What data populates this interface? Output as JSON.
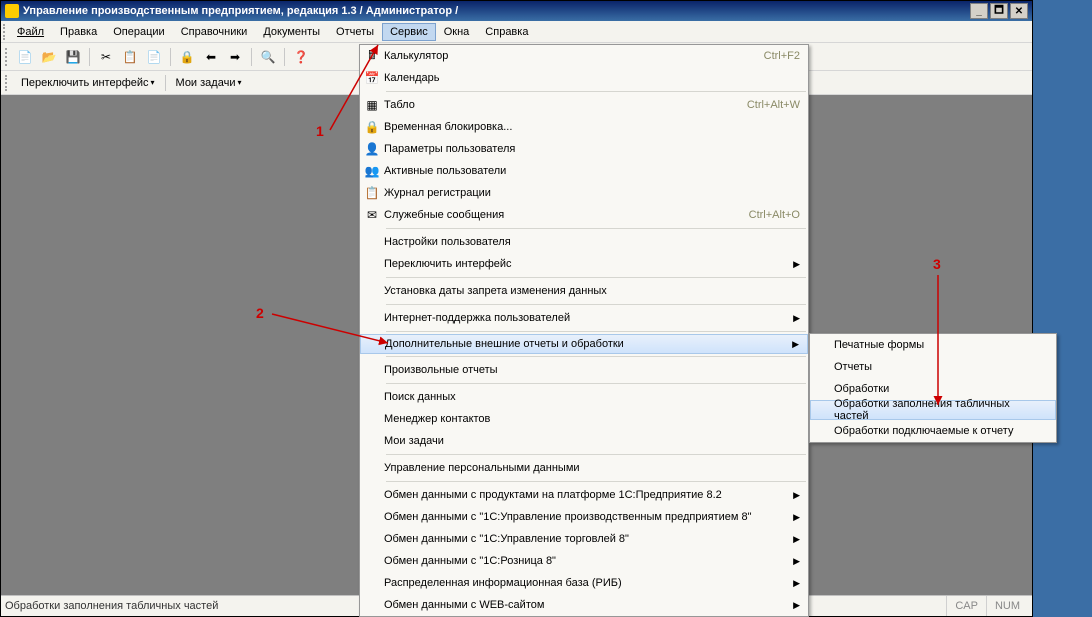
{
  "title": "Управление производственным предприятием, редакция 1.3 / Администратор /",
  "menubar": [
    "Файл",
    "Правка",
    "Операции",
    "Справочники",
    "Документы",
    "Отчеты",
    "Сервис",
    "Окна",
    "Справка"
  ],
  "subbar": {
    "switch": "Переключить интерфейс",
    "tasks": "Мои задачи"
  },
  "status": {
    "text": "Обработки заполнения табличных частей",
    "cap": "CAP",
    "num": "NUM"
  },
  "menu": {
    "items": [
      {
        "icon": "🖩",
        "label": "Калькулятор",
        "shortcut": "Ctrl+F2"
      },
      {
        "icon": "📅",
        "label": "Календарь",
        "shortcut": ""
      },
      {
        "sep": true
      },
      {
        "icon": "▦",
        "label": "Табло",
        "shortcut": "Ctrl+Alt+W"
      },
      {
        "icon": "🔒",
        "label": "Временная блокировка...",
        "shortcut": ""
      },
      {
        "icon": "👤",
        "label": "Параметры пользователя",
        "shortcut": ""
      },
      {
        "icon": "👥",
        "label": "Активные пользователи",
        "shortcut": ""
      },
      {
        "icon": "📋",
        "label": "Журнал регистрации",
        "shortcut": ""
      },
      {
        "icon": "✉",
        "label": "Служебные сообщения",
        "shortcut": "Ctrl+Alt+O"
      },
      {
        "sep": true
      },
      {
        "icon": "",
        "label": "Настройки пользователя",
        "shortcut": ""
      },
      {
        "icon": "",
        "label": "Переключить интерфейс",
        "shortcut": "",
        "sub": true
      },
      {
        "sep": true
      },
      {
        "icon": "",
        "label": "Установка даты запрета изменения данных",
        "shortcut": ""
      },
      {
        "sep": true
      },
      {
        "icon": "",
        "label": "Интернет-поддержка пользователей",
        "shortcut": "",
        "sub": true
      },
      {
        "sep": true
      },
      {
        "icon": "",
        "label": "Дополнительные внешние отчеты и обработки",
        "shortcut": "",
        "sub": true,
        "hl": true
      },
      {
        "sep": true
      },
      {
        "icon": "",
        "label": "Произвольные отчеты",
        "shortcut": ""
      },
      {
        "sep": true
      },
      {
        "icon": "",
        "label": "Поиск данных",
        "shortcut": ""
      },
      {
        "icon": "",
        "label": "Менеджер контактов",
        "shortcut": ""
      },
      {
        "icon": "",
        "label": "Мои задачи",
        "shortcut": ""
      },
      {
        "sep": true
      },
      {
        "icon": "",
        "label": "Управление персональными данными",
        "shortcut": ""
      },
      {
        "sep": true
      },
      {
        "icon": "",
        "label": "Обмен данными с продуктами на платформе 1С:Предприятие 8.2",
        "shortcut": "",
        "sub": true
      },
      {
        "icon": "",
        "label": "Обмен данными с \"1С:Управление производственным предприятием 8\"",
        "shortcut": "",
        "sub": true
      },
      {
        "icon": "",
        "label": "Обмен данными с \"1С:Управление торговлей 8\"",
        "shortcut": "",
        "sub": true
      },
      {
        "icon": "",
        "label": "Обмен данными с \"1С:Розница 8\"",
        "shortcut": "",
        "sub": true
      },
      {
        "icon": "",
        "label": "Распределенная информационная база (РИБ)",
        "shortcut": "",
        "sub": true
      },
      {
        "icon": "",
        "label": "Обмен данными с WEB-сайтом",
        "shortcut": "",
        "sub": true
      }
    ]
  },
  "submenu": [
    {
      "label": "Печатные формы"
    },
    {
      "label": "Отчеты"
    },
    {
      "label": "Обработки"
    },
    {
      "label": "Обработки заполнения табличных частей",
      "hl": true
    },
    {
      "label": "Обработки подключаемые к отчету"
    }
  ],
  "anno": {
    "a1": "1",
    "a2": "2",
    "a3": "3"
  },
  "toolbar_icons": [
    "📄",
    "📂",
    "💾",
    "",
    "✂",
    "📋",
    "📄",
    "",
    "🔒",
    "⬅",
    "➡",
    "",
    "🔍",
    "",
    "❓"
  ]
}
